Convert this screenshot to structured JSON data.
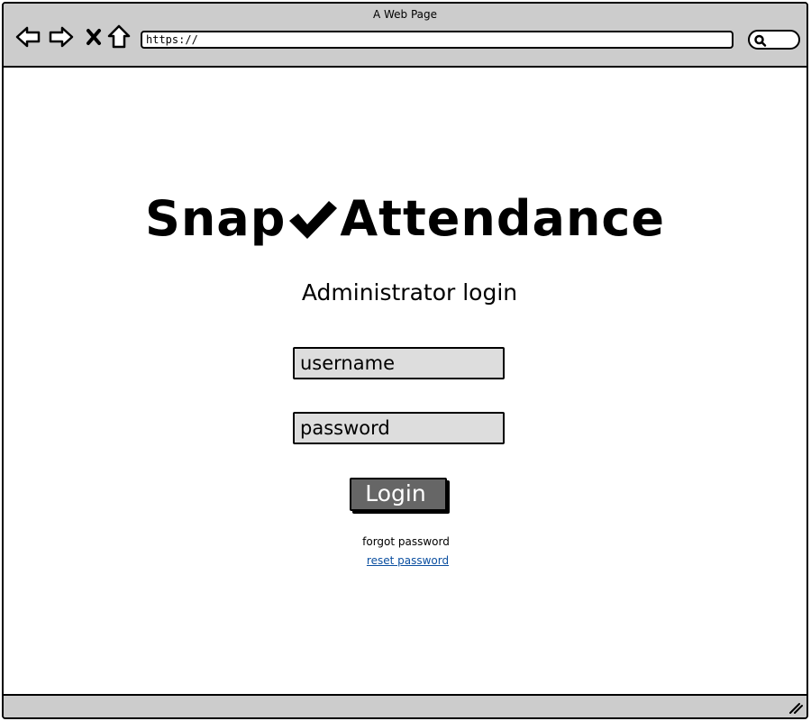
{
  "window": {
    "title": "A Web Page"
  },
  "browser": {
    "back_icon": "arrow-left-icon",
    "forward_icon": "arrow-right-icon",
    "stop_icon": "close-icon",
    "home_icon": "home-icon",
    "url": "https://",
    "search_icon": "search-icon"
  },
  "page": {
    "brand_left": "Snap",
    "brand_icon": "checkmark-icon",
    "brand_right": "Attendance",
    "subtitle": "Administrator login",
    "username_placeholder": "username",
    "password_placeholder": "password",
    "login_label": "Login",
    "forgot_text": "forgot password",
    "reset_link": "reset password"
  },
  "colors": {
    "chrome": "#cccccc",
    "field_bg": "#dddddd",
    "button_bg": "#666666",
    "link": "#0b4fa0"
  }
}
